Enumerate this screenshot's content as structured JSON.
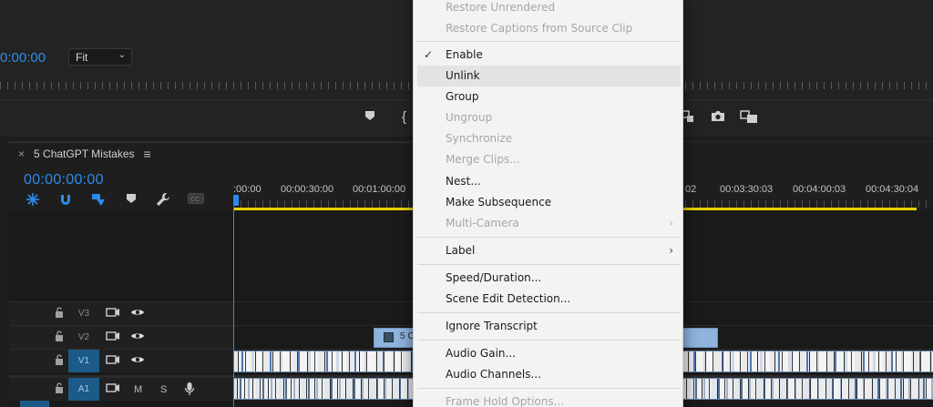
{
  "monitor": {
    "timecode": "0:00:00",
    "fit_select": {
      "value": "Fit"
    }
  },
  "timeline": {
    "tab_title": "5 ChatGPT Mistakes",
    "timecode": "00:00:00:00",
    "ruler_labels": [
      ":00:00",
      "00:00:30:00",
      "00:01:00:00",
      "02",
      "00:03:30:03",
      "00:04:00:03",
      "00:04:30:04"
    ],
    "tracks": [
      {
        "name": "V3",
        "kind": "video",
        "active": false
      },
      {
        "name": "V2",
        "kind": "video",
        "active": false
      },
      {
        "name": "V1",
        "kind": "video",
        "active": true
      },
      {
        "name": "A1",
        "kind": "audio",
        "active": true,
        "mute_label": "M",
        "solo_label": "S"
      }
    ],
    "v2_clip_label": "5 C"
  },
  "context_menu": {
    "items": [
      {
        "label": "Restore Unrendered",
        "enabled": false
      },
      {
        "label": "Restore Captions from Source Clip",
        "enabled": false
      },
      {
        "label": "Enable",
        "enabled": true,
        "checked": true
      },
      {
        "label": "Unlink",
        "enabled": true,
        "hovered": true
      },
      {
        "label": "Group",
        "enabled": true
      },
      {
        "label": "Ungroup",
        "enabled": false
      },
      {
        "label": "Synchronize",
        "enabled": false
      },
      {
        "label": "Merge Clips...",
        "enabled": false
      },
      {
        "label": "Nest...",
        "enabled": true
      },
      {
        "label": "Make Subsequence",
        "enabled": true
      },
      {
        "label": "Multi-Camera",
        "enabled": false,
        "submenu": true
      },
      {
        "label": "Label",
        "enabled": true,
        "submenu": true
      },
      {
        "label": "Speed/Duration...",
        "enabled": true
      },
      {
        "label": "Scene Edit Detection...",
        "enabled": true
      },
      {
        "label": "Ignore Transcript",
        "enabled": true
      },
      {
        "label": "Audio Gain...",
        "enabled": true
      },
      {
        "label": "Audio Channels...",
        "enabled": true
      },
      {
        "label": "Frame Hold Options...",
        "enabled": false
      }
    ]
  },
  "colors": {
    "accent_blue": "#2d8ceb",
    "work_area_yellow": "#e8d100",
    "active_track": "#1c5b88",
    "clip_blue": "#8fb3dc"
  }
}
